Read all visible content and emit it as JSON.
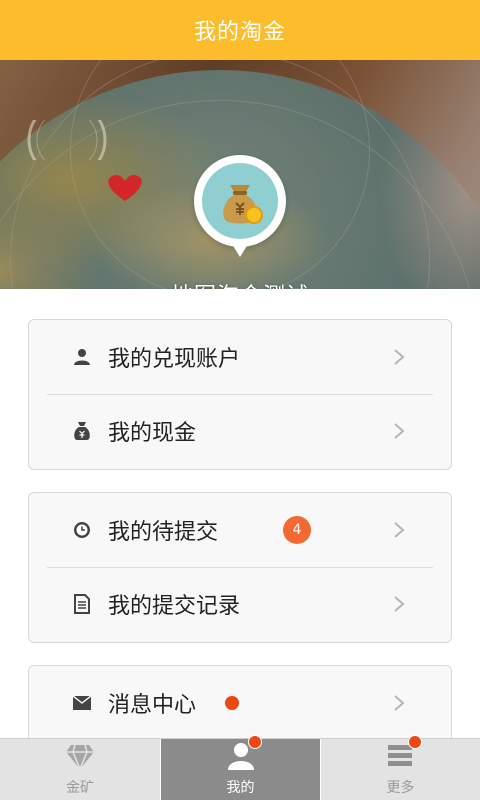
{
  "header": {
    "title": "我的淘金"
  },
  "hero": {
    "title": "地图淘金测试"
  },
  "menu_groups": [
    {
      "items": [
        {
          "label": "我的兑现账户",
          "icon": "user-icon"
        },
        {
          "label": "我的现金",
          "icon": "money-bag-icon"
        }
      ]
    },
    {
      "items": [
        {
          "label": "我的待提交",
          "icon": "clock-icon",
          "badge": "4"
        },
        {
          "label": "我的提交记录",
          "icon": "document-icon"
        }
      ]
    },
    {
      "items": [
        {
          "label": "消息中心",
          "icon": "mail-icon",
          "has_dot": true
        }
      ]
    }
  ],
  "tabbar": {
    "tabs": [
      {
        "label": "金矿",
        "icon": "diamond-icon"
      },
      {
        "label": "我的",
        "icon": "person-icon",
        "active": true,
        "has_dot": true
      },
      {
        "label": "更多",
        "icon": "list-icon",
        "has_dot": true
      }
    ]
  },
  "colors": {
    "header": "#fbbd2c",
    "badge": "#f26a32",
    "dot": "#ea4a12",
    "active_tab": "#8b8b8b"
  }
}
